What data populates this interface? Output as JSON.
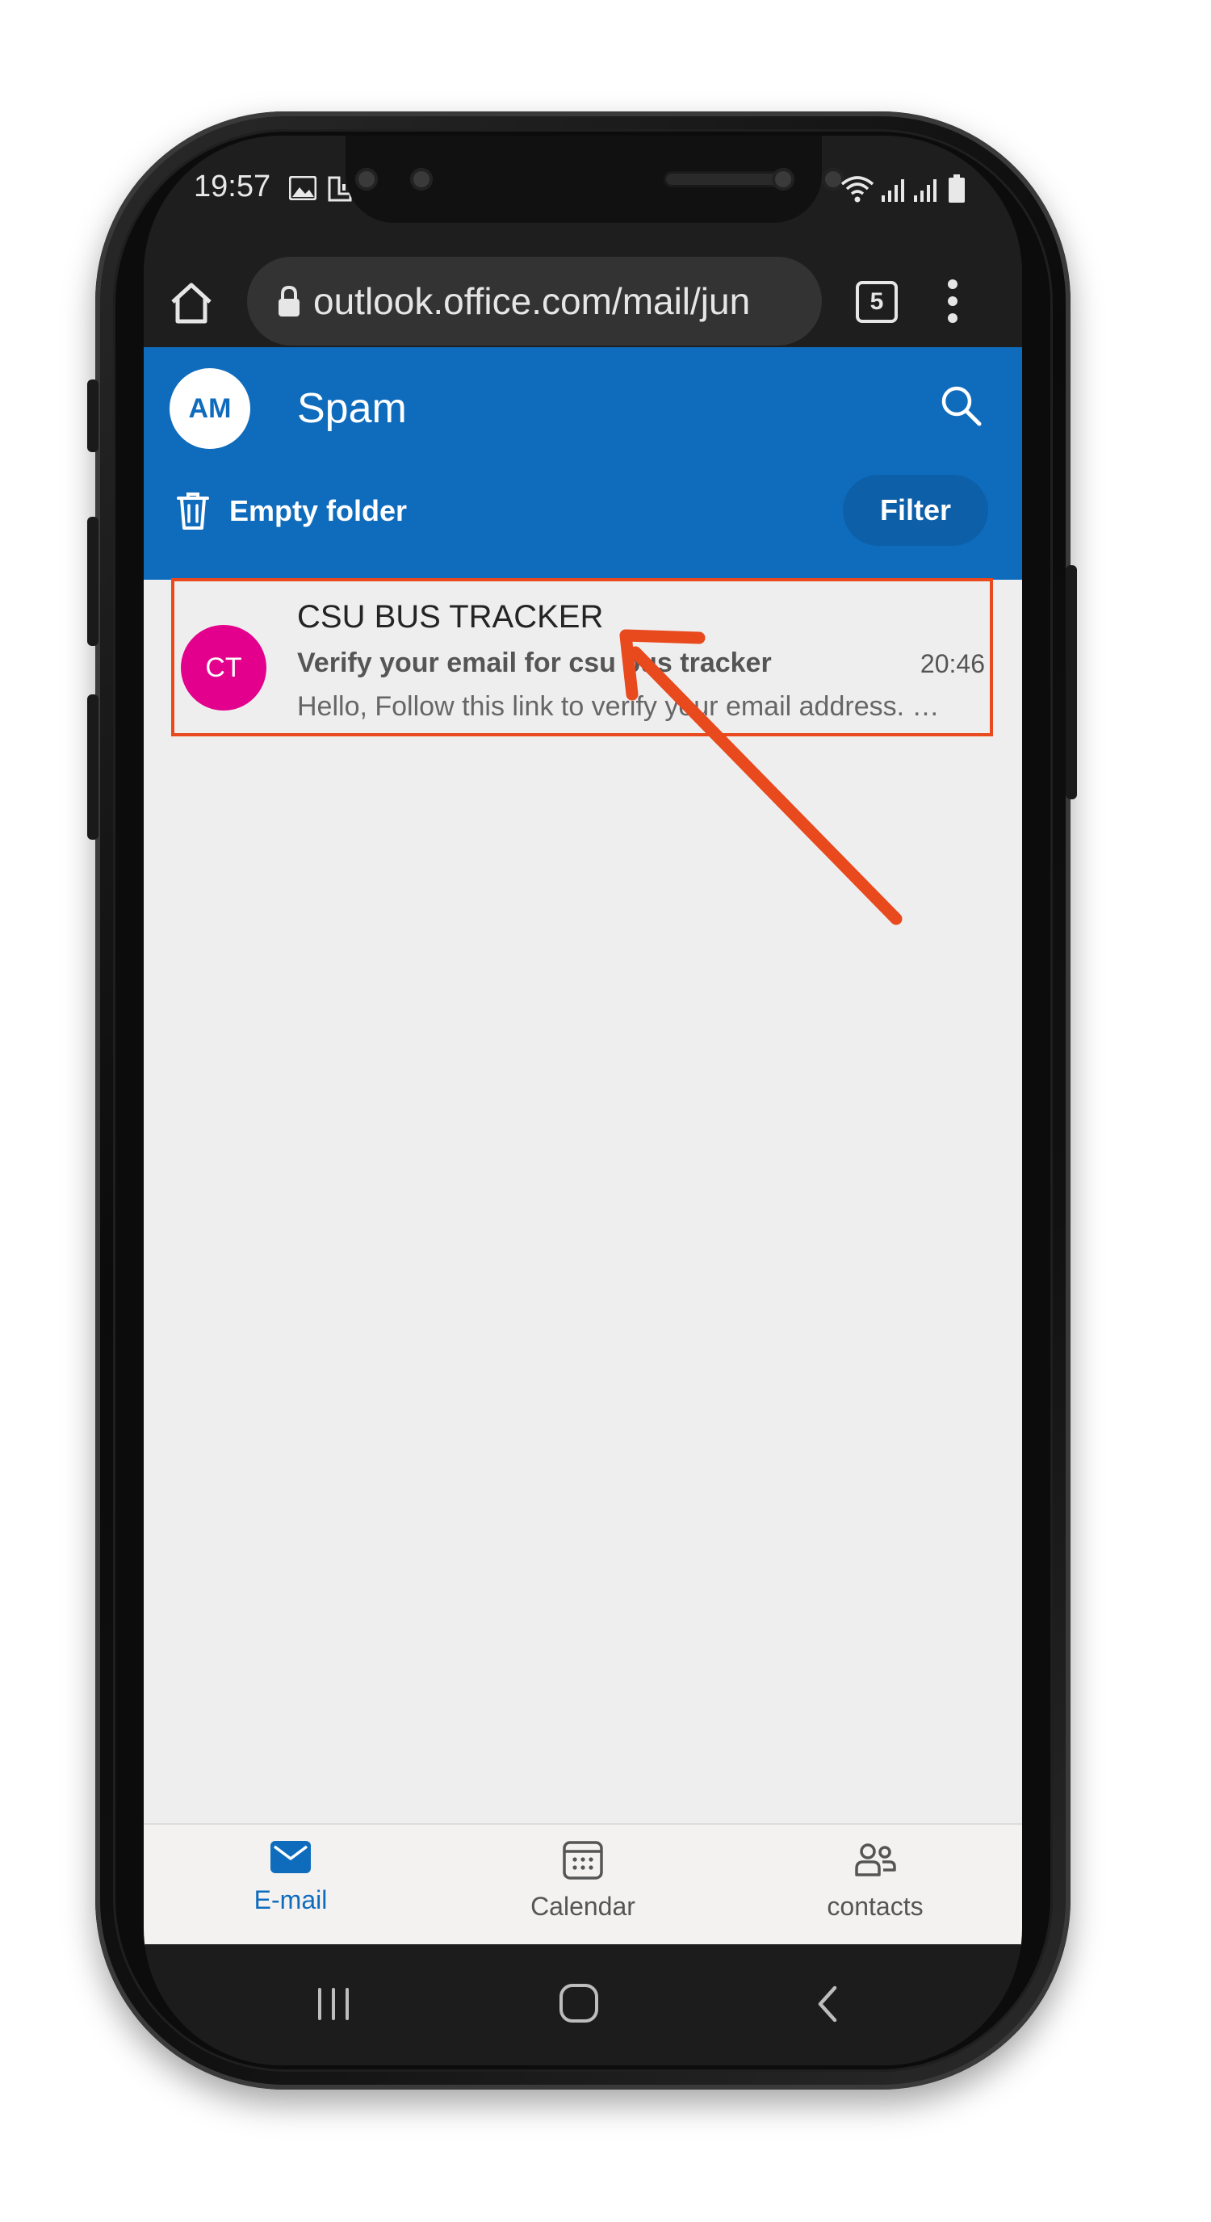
{
  "status_bar": {
    "time": "19:57"
  },
  "browser": {
    "url": "outlook.office.com/mail/jun",
    "tab_count": "5"
  },
  "header": {
    "avatar_initials": "AM",
    "folder_title": "Spam",
    "empty_folder_label": "Empty folder",
    "filter_label": "Filter"
  },
  "messages": [
    {
      "avatar_initials": "CT",
      "avatar_color": "#e3008c",
      "sender": "CSU BUS TRACKER",
      "subject": "Verify your email for csu bus tracker",
      "time": "20:46",
      "preview": "Hello, Follow this link to verify your email address. …"
    }
  ],
  "bottom_nav": {
    "items": [
      {
        "label": "E-mail",
        "icon": "mail-icon",
        "active": true
      },
      {
        "label": "Calendar",
        "icon": "calendar-icon",
        "active": false
      },
      {
        "label": "contacts",
        "icon": "contacts-icon",
        "active": false
      }
    ]
  },
  "colors": {
    "brand": "#0f6cbd",
    "annotation": "#e8491d"
  }
}
